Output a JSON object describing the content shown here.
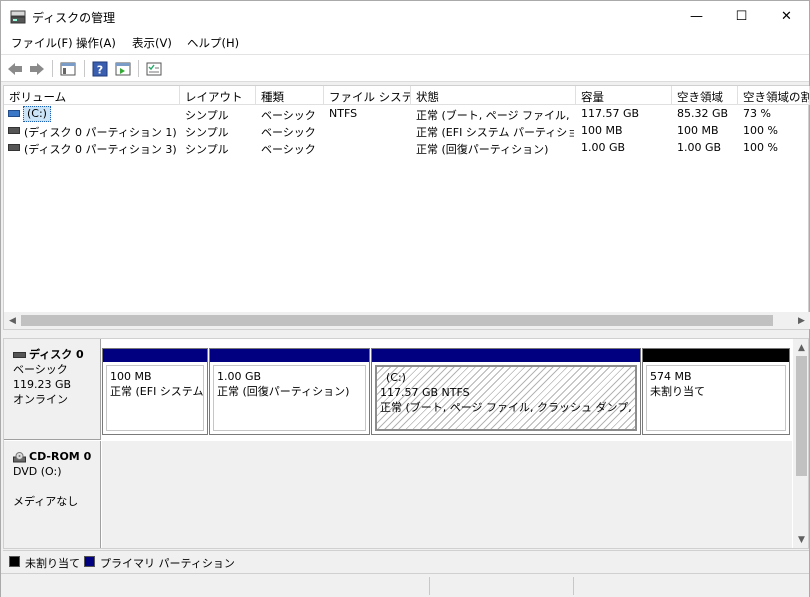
{
  "window": {
    "title": "ディスクの管理",
    "minimize": "—",
    "maximize": "☐",
    "close": "✕"
  },
  "menu": [
    "ファイル(F)",
    "操作(A)",
    "表示(V)",
    "ヘルプ(H)"
  ],
  "columns": [
    "ボリューム",
    "レイアウト",
    "種類",
    "ファイル システム",
    "状態",
    "容量",
    "空き領域",
    "空き領域の割"
  ],
  "volumes": [
    {
      "name": "(C:)",
      "layout": "シンプル",
      "type": "ベーシック",
      "fs": "NTFS",
      "status": "正常 (ブート, ページ ファイル, ク...",
      "capacity": "117.57 GB",
      "free": "85.32 GB",
      "pct": "73 %"
    },
    {
      "name": "(ディスク 0 パーティション 1)",
      "layout": "シンプル",
      "type": "ベーシック",
      "fs": "",
      "status": "正常 (EFI システム パーティション)",
      "capacity": "100 MB",
      "free": "100 MB",
      "pct": "100 %"
    },
    {
      "name": "(ディスク 0 パーティション 3)",
      "layout": "シンプル",
      "type": "ベーシック",
      "fs": "",
      "status": "正常 (回復パーティション)",
      "capacity": "1.00 GB",
      "free": "1.00 GB",
      "pct": "100 %"
    }
  ],
  "disk0": {
    "name": "ディスク 0",
    "type": "ベーシック",
    "size": "119.23 GB",
    "state": "オンライン",
    "partitions": [
      {
        "line1": "100 MB",
        "line2": "正常 (EFI システム ,",
        "label": ""
      },
      {
        "line1": "1.00 GB",
        "line2": "正常 (回復パーティション)",
        "label": ""
      },
      {
        "label": "(C:)",
        "line1": "117.57 GB NTFS",
        "line2": "正常 (ブート, ページ ファイル, クラッシュ ダンプ, ベーシック"
      },
      {
        "line1": "574 MB",
        "line2": "未割り当て",
        "label": ""
      }
    ]
  },
  "cdrom": {
    "name": "CD-ROM 0",
    "type": "DVD (O:)",
    "state": "メディアなし"
  },
  "legend": {
    "unallocated": "未割り当て",
    "primary": "プライマリ パーティション"
  },
  "colors": {
    "primary": "#000080",
    "unallocated": "#000000",
    "selection": "#cce4f7"
  }
}
